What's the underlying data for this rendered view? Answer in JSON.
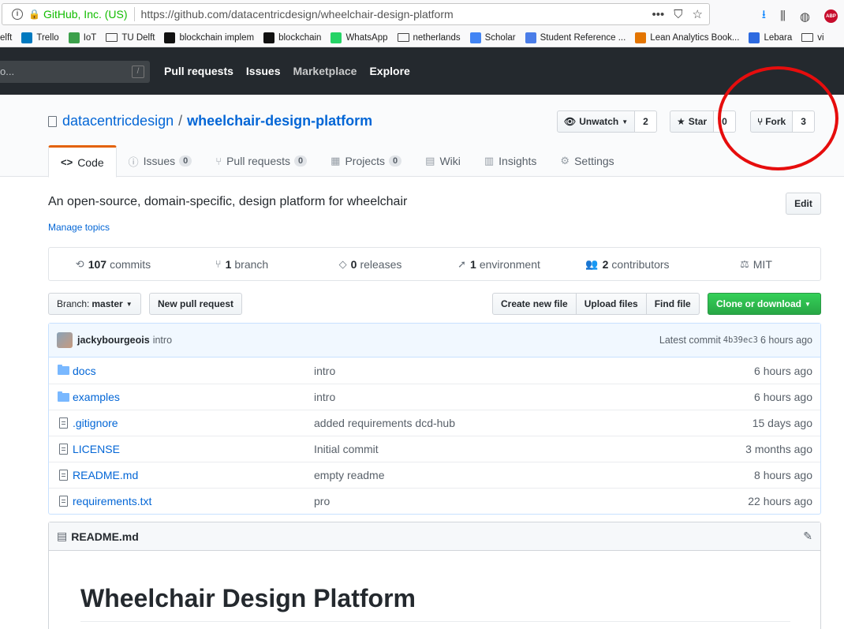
{
  "browser": {
    "site_identity": "GitHub, Inc. (US)",
    "url": "https://github.com/datacentricdesign/wheelchair-design-platform",
    "more_icon": "•••",
    "bookmarks": [
      {
        "label": "elft",
        "icon": "none"
      },
      {
        "label": "Trello",
        "icon": "trello-icon",
        "color": "#0079bf"
      },
      {
        "label": "IoT",
        "icon": "iot-icon",
        "color": "#3ca04b"
      },
      {
        "label": "TU Delft",
        "icon": "folder-icon"
      },
      {
        "label": "blockchain implem",
        "icon": "github-icon",
        "color": "#111111"
      },
      {
        "label": "blockchain",
        "icon": "ig-icon",
        "color": "#111111"
      },
      {
        "label": "WhatsApp",
        "icon": "whatsapp-icon",
        "color": "#25d366"
      },
      {
        "label": "netherlands",
        "icon": "folder-icon"
      },
      {
        "label": "Scholar",
        "icon": "scholar-icon",
        "color": "#4285f4"
      },
      {
        "label": "Student Reference ...",
        "icon": "docs-icon",
        "color": "#4a7de8"
      },
      {
        "label": "Lean Analytics Book...",
        "icon": "analytics-icon",
        "color": "#e37400"
      },
      {
        "label": "Lebara",
        "icon": "lebara-icon",
        "color": "#2d6ae0"
      },
      {
        "label": "vi",
        "icon": "folder-icon"
      }
    ]
  },
  "gh_header": {
    "search_placeholder": "o...",
    "search_shortcut": "/",
    "nav": [
      "Pull requests",
      "Issues",
      "Marketplace",
      "Explore"
    ]
  },
  "repo": {
    "owner": "datacentricdesign",
    "separator": "/",
    "name": "wheelchair-design-platform",
    "watch_label": "Unwatch",
    "watch_count": "2",
    "star_label": "Star",
    "star_count": "0",
    "fork_label": "Fork",
    "fork_count": "3"
  },
  "tabs": [
    {
      "label": "Code",
      "icon": "<>",
      "count": ""
    },
    {
      "label": "Issues",
      "icon": "!",
      "count": "0"
    },
    {
      "label": "Pull requests",
      "icon": "⑂",
      "count": "0"
    },
    {
      "label": "Projects",
      "icon": "▦",
      "count": "0"
    },
    {
      "label": "Wiki",
      "icon": "▤",
      "count": ""
    },
    {
      "label": "Insights",
      "icon": "▥",
      "count": ""
    },
    {
      "label": "Settings",
      "icon": "⚙",
      "count": ""
    }
  ],
  "about": {
    "description": "An open-source, domain-specific, design platform for wheelchair",
    "manage_topics": "Manage topics",
    "edit_label": "Edit"
  },
  "summary": [
    {
      "count": "107",
      "label": "commits",
      "icon": "⟲"
    },
    {
      "count": "1",
      "label": "branch",
      "icon": "⑂"
    },
    {
      "count": "0",
      "label": "releases",
      "icon": "◇"
    },
    {
      "count": "1",
      "label": "environment",
      "icon": "➚"
    },
    {
      "count": "2",
      "label": "contributors",
      "icon": "👥"
    },
    {
      "count": "",
      "label": "MIT",
      "icon": "⚖"
    }
  ],
  "filenav": {
    "branch_prefix": "Branch:",
    "branch_name": "master",
    "new_pr": "New pull request",
    "create_file": "Create new file",
    "upload_files": "Upload files",
    "find_file": "Find file",
    "clone": "Clone or download"
  },
  "latest_commit": {
    "author": "jackybourgeois",
    "message": "intro",
    "prefix": "Latest commit",
    "sha": "4b39ec3",
    "age": "6 hours ago"
  },
  "files": [
    {
      "name": "docs",
      "type": "dir",
      "message": "intro",
      "age": "6 hours ago"
    },
    {
      "name": "examples",
      "type": "dir",
      "message": "intro",
      "age": "6 hours ago"
    },
    {
      "name": ".gitignore",
      "type": "file",
      "message": "added requirements dcd-hub",
      "age": "15 days ago"
    },
    {
      "name": "LICENSE",
      "type": "file",
      "message": "Initial commit",
      "age": "3 months ago"
    },
    {
      "name": "README.md",
      "type": "file",
      "message": "empty readme",
      "age": "8 hours ago"
    },
    {
      "name": "requirements.txt",
      "type": "file",
      "message": "pro",
      "age": "22 hours ago"
    }
  ],
  "readme": {
    "filename": "README.md",
    "heading": "Wheelchair Design Platform"
  },
  "colors": {
    "annotation": "#e60d0d",
    "link": "#0366d6",
    "header_bg": "#24292e",
    "clone_green": "#28a745"
  }
}
